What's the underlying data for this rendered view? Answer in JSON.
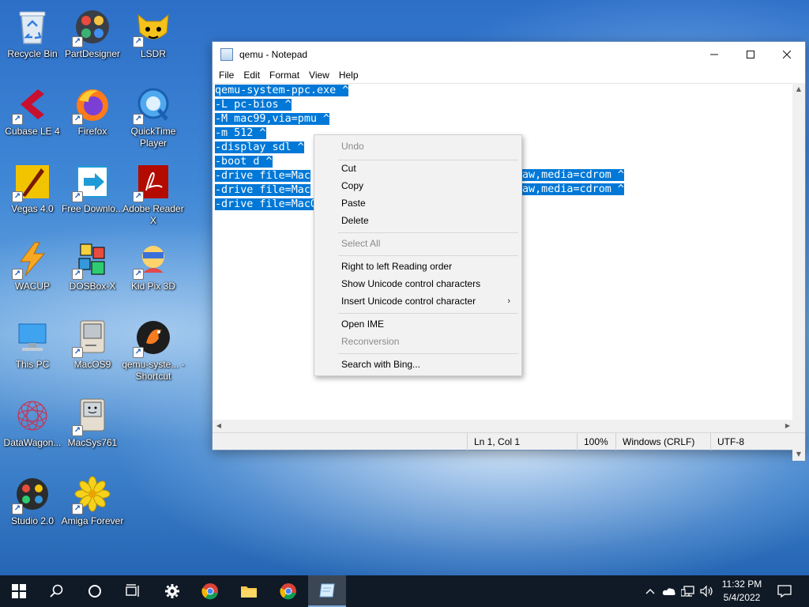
{
  "desktop": {
    "icons": [
      {
        "label": "Recycle Bin"
      },
      {
        "label": "PartDesigner"
      },
      {
        "label": "LSDR"
      },
      {
        "label": "Cubase LE 4"
      },
      {
        "label": "Firefox"
      },
      {
        "label": "QuickTime Player"
      },
      {
        "label": "Vegas 4.0"
      },
      {
        "label": "Free Downlo..."
      },
      {
        "label": "Adobe Reader X"
      },
      {
        "label": "WACUP"
      },
      {
        "label": "DOSBox-X"
      },
      {
        "label": "Kid Pix 3D"
      },
      {
        "label": "This PC"
      },
      {
        "label": "MacOS9"
      },
      {
        "label": "qemu-syste... - Shortcut"
      },
      {
        "label": "DataWagon..."
      },
      {
        "label": "MacSys761"
      },
      {
        "label": "Studio 2.0"
      },
      {
        "label": "Amiga Forever"
      }
    ]
  },
  "notepad": {
    "title": "qemu - Notepad",
    "menu": [
      "File",
      "Edit",
      "Format",
      "View",
      "Help"
    ],
    "lines": [
      "qemu-system-ppc.exe ^",
      "-L pc-bios ^",
      "-M mac99,via=pmu ^",
      "-m 512 ^",
      "-display sdl ^",
      "-boot d ^",
      "-drive file=Mac",
      "-drive file=Mac",
      "-drive file=MacO"
    ],
    "hidden_tails": [
      "aw,media=cdrom ^",
      "aw,media=cdrom ^"
    ],
    "status": {
      "position": "Ln 1, Col 1",
      "zoom": "100%",
      "line_endings": "Windows (CRLF)",
      "encoding": "UTF-8"
    }
  },
  "context_menu": {
    "undo": "Undo",
    "cut": "Cut",
    "copy": "Copy",
    "paste": "Paste",
    "delete": "Delete",
    "select_all": "Select All",
    "rtl": "Right to left Reading order",
    "show_unicode": "Show Unicode control characters",
    "insert_unicode": "Insert Unicode control character",
    "open_ime": "Open IME",
    "reconversion": "Reconversion",
    "search_bing": "Search with Bing..."
  },
  "taskbar": {
    "time": "11:32 PM",
    "date": "5/4/2022"
  },
  "colors": {
    "selection": "#0078d7",
    "taskbar": "#101a26"
  }
}
